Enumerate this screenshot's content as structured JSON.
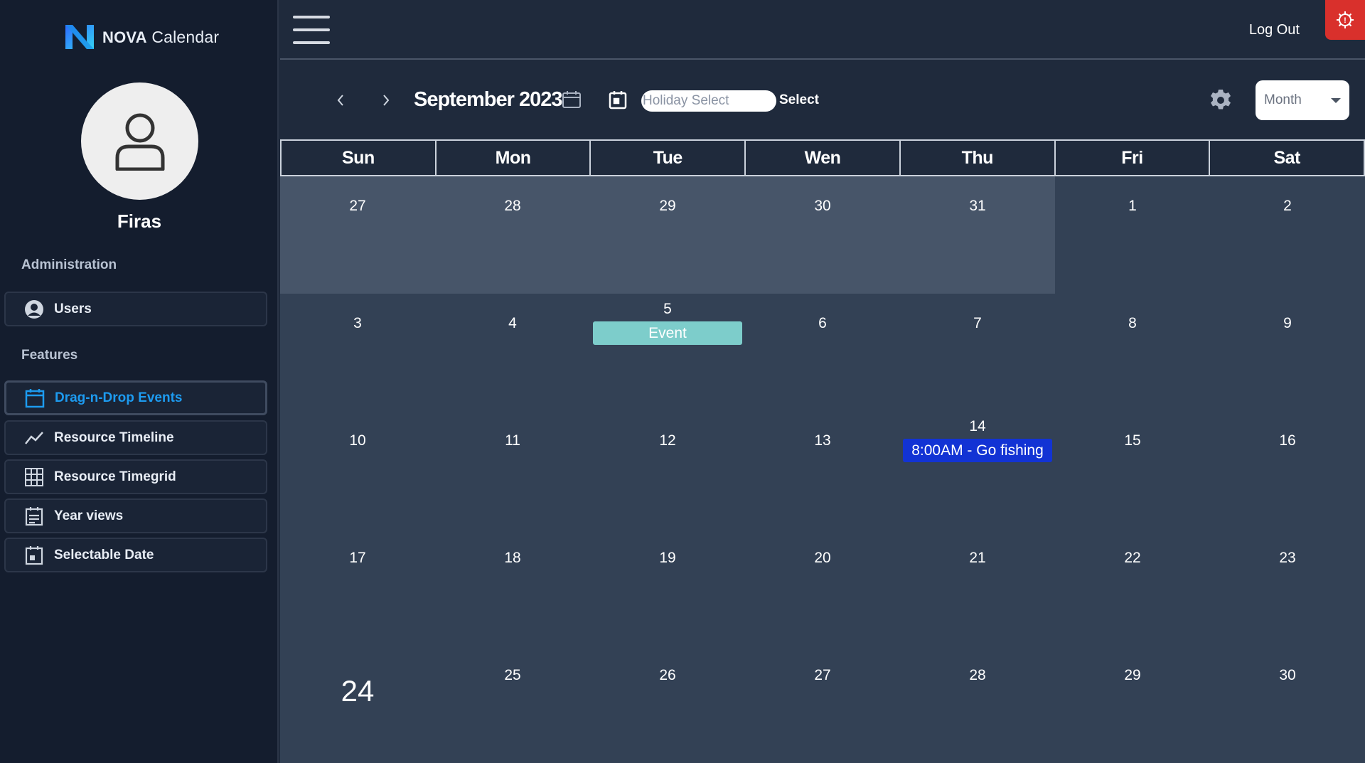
{
  "brand": {
    "bold": "NOVA",
    "rest": " Calendar"
  },
  "user": {
    "name": "Firas"
  },
  "sidebar": {
    "admin_label": "Administration",
    "features_label": "Features",
    "items": [
      {
        "label": "Users",
        "icon": "user-circle-icon"
      },
      {
        "label": "Drag-n-Drop Events",
        "icon": "calendar-icon",
        "active": true
      },
      {
        "label": "Resource Timeline",
        "icon": "line-chart-icon"
      },
      {
        "label": "Resource Timegrid",
        "icon": "grid-icon"
      },
      {
        "label": "Year views",
        "icon": "list-calendar-icon"
      },
      {
        "label": "Selectable Date",
        "icon": "calendar-check-icon"
      }
    ]
  },
  "header": {
    "logout": "Log Out"
  },
  "toolbar": {
    "title": "September 2023",
    "holiday_placeholder": "Holiday Select",
    "select_label": "Select",
    "view": "Month"
  },
  "calendar": {
    "days_of_week": [
      "Sun",
      "Mon",
      "Tue",
      "Wen",
      "Thu",
      "Fri",
      "Sat"
    ],
    "weeks": [
      [
        {
          "d": "27",
          "other": true
        },
        {
          "d": "28",
          "other": true
        },
        {
          "d": "29",
          "other": true
        },
        {
          "d": "30",
          "other": true
        },
        {
          "d": "31",
          "other": true
        },
        {
          "d": "1"
        },
        {
          "d": "2"
        }
      ],
      [
        {
          "d": "3"
        },
        {
          "d": "4"
        },
        {
          "d": "5",
          "event": {
            "title": "Event",
            "color": "teal"
          }
        },
        {
          "d": "6"
        },
        {
          "d": "7"
        },
        {
          "d": "8"
        },
        {
          "d": "9"
        }
      ],
      [
        {
          "d": "10"
        },
        {
          "d": "11"
        },
        {
          "d": "12"
        },
        {
          "d": "13"
        },
        {
          "d": "14",
          "event": {
            "title": "8:00AM - Go fishing",
            "color": "blue"
          }
        },
        {
          "d": "15"
        },
        {
          "d": "16"
        }
      ],
      [
        {
          "d": "17"
        },
        {
          "d": "18"
        },
        {
          "d": "19"
        },
        {
          "d": "20"
        },
        {
          "d": "21"
        },
        {
          "d": "22"
        },
        {
          "d": "23"
        }
      ],
      [
        {
          "d": "24",
          "today": true
        },
        {
          "d": "25"
        },
        {
          "d": "26"
        },
        {
          "d": "27"
        },
        {
          "d": "28"
        },
        {
          "d": "29"
        },
        {
          "d": "30"
        }
      ]
    ]
  },
  "colors": {
    "sidebar_bg": "#141d2e",
    "main_bg": "#1f2a3c",
    "cell_bg": "#334155",
    "other_month_bg": "#475569",
    "accent": "#1d9bf0",
    "event_teal": "#7dcdcb",
    "event_blue": "#1233d4",
    "badge_red": "#d9302c"
  }
}
